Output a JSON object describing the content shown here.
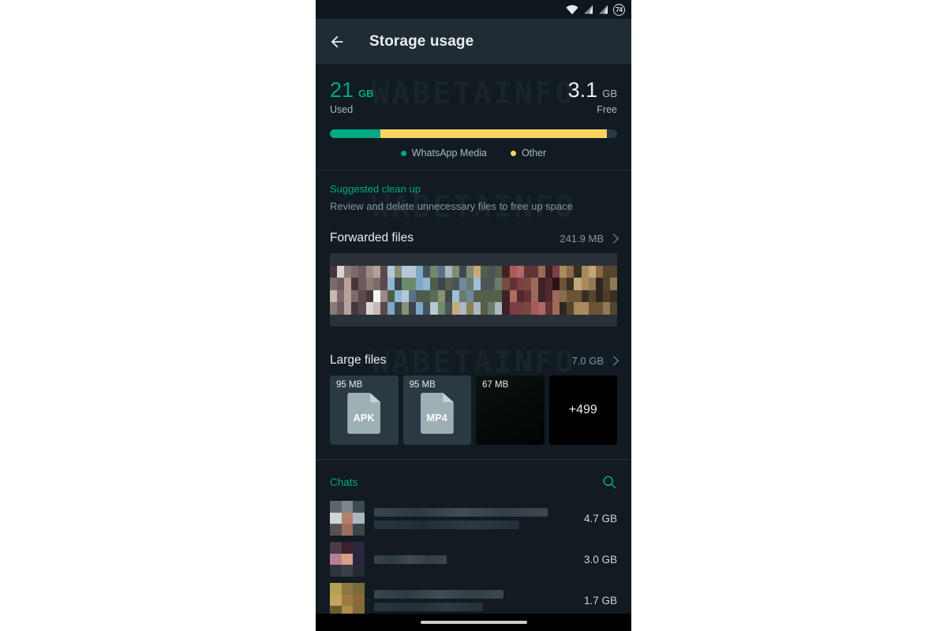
{
  "status_bar": {
    "wifi_icon": "wifi-icon",
    "signal_icon_1": "cellular-signal-icon",
    "signal_icon_2": "cellular-signal-icon",
    "battery_level": "74"
  },
  "app_bar": {
    "back_icon": "back-arrow-icon",
    "title": "Storage usage"
  },
  "summary": {
    "used": {
      "value": "21",
      "unit": "GB",
      "label": "Used"
    },
    "free": {
      "value": "3.1",
      "unit": "GB",
      "label": "Free"
    },
    "bar": {
      "media_percent": 17.5,
      "other_percent": 79.0,
      "media_color": "#00a884",
      "other_color": "#fad564",
      "track_color": "#2a3942"
    },
    "legend": [
      {
        "label": "WhatsApp Media",
        "color": "#00a884"
      },
      {
        "label": "Other",
        "color": "#fad564"
      }
    ]
  },
  "cleanup": {
    "title": "Suggested clean up",
    "subtitle": "Review and delete unnecessary files to free up space",
    "forwarded": {
      "title": "Forwarded files",
      "size": "241.9 MB",
      "chevron_icon": "chevron-right-icon"
    },
    "large": {
      "title": "Large files",
      "size": "7.0 GB",
      "chevron_icon": "chevron-right-icon",
      "cards": [
        {
          "size": "95 MB",
          "ext": "APK",
          "kind": "doc"
        },
        {
          "size": "95 MB",
          "ext": "MP4",
          "kind": "doc"
        },
        {
          "size": "67 MB",
          "ext": "",
          "kind": "video"
        },
        {
          "size": "",
          "ext": "",
          "kind": "more",
          "count": "+499"
        }
      ]
    }
  },
  "chats": {
    "title": "Chats",
    "search_icon": "search-icon",
    "rows": [
      {
        "name": "",
        "size": "4.7 GB"
      },
      {
        "name": "",
        "size": "3.0 GB"
      },
      {
        "name": "",
        "size": "1.7 GB"
      }
    ]
  },
  "nav_bar": {
    "home_indicator": "home-indicator"
  },
  "watermark": {
    "text": "WABETAINFO"
  }
}
